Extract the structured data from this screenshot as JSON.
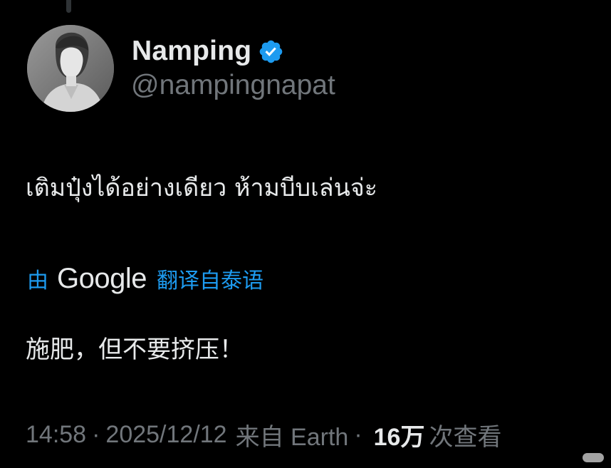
{
  "tweet": {
    "author": {
      "display_name": "Namping",
      "handle": "@nampingnapat",
      "verified_icon": "verified-badge-icon",
      "verified_color": "#1d9bf0"
    },
    "text": "เติมปุ๋งได้อย่างเดียว ห้ามบีบเล่นจ่ะ",
    "translation": {
      "by_label": "由",
      "provider": "Google",
      "from_label": "翻译自泰语",
      "text": "施肥，但不要挤压！"
    },
    "meta": {
      "time": "14:58",
      "separator": "·",
      "date": "2025/12/12",
      "source": "来自 Earth",
      "views_count": "16万",
      "views_label": "次查看"
    }
  },
  "colors": {
    "background": "#000000",
    "primary_text": "#e7e9ea",
    "secondary_text": "#71767b",
    "link": "#1d9bf0"
  }
}
